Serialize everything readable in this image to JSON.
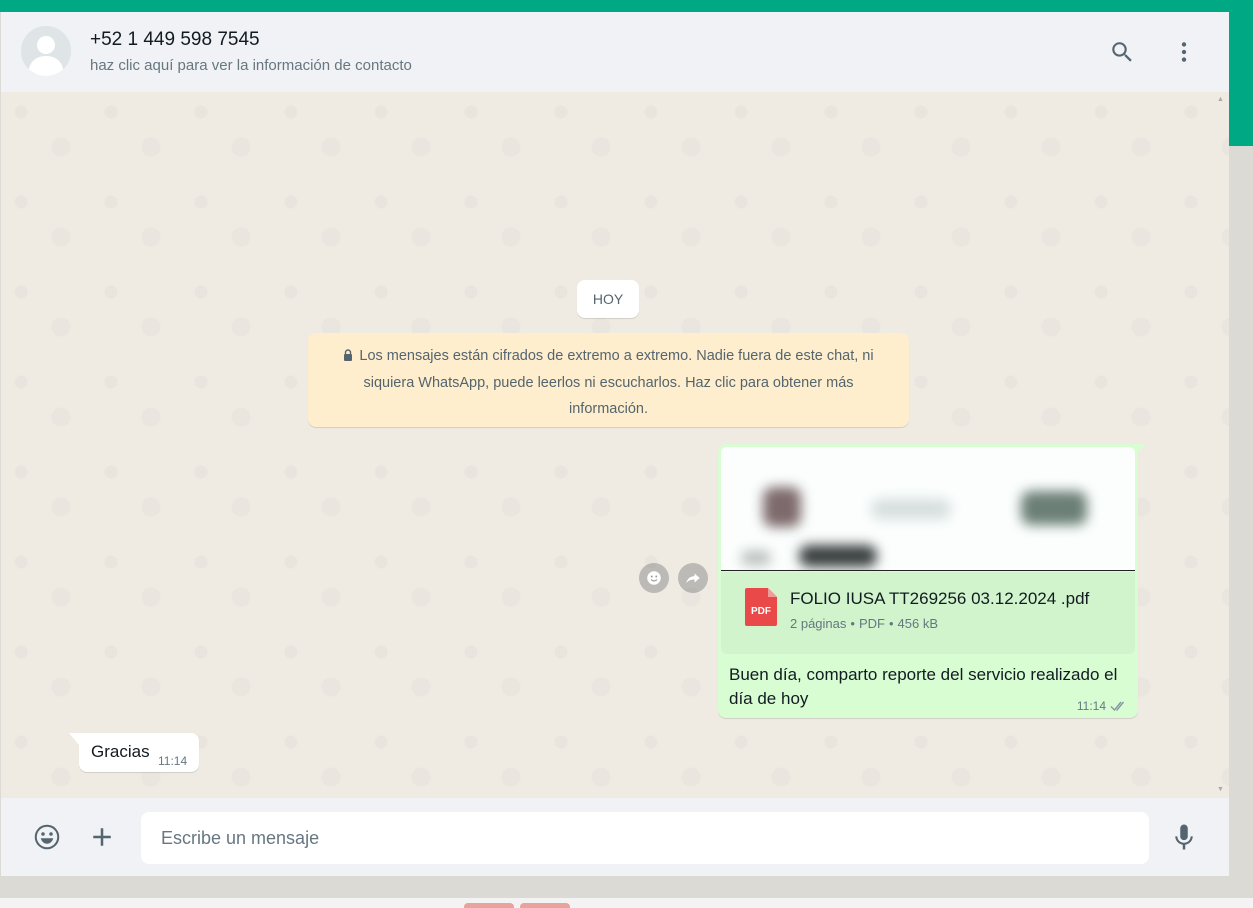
{
  "header": {
    "contact_name": "+52 1 449 598 7545",
    "contact_subtitle": "haz clic aquí para ver la información de contacto",
    "icons": [
      "avatar-placeholder-icon",
      "search-icon",
      "menu-kebab-icon"
    ]
  },
  "chat": {
    "day_label": "HOY",
    "encryption_notice": "Los mensajes están cifrados de extremo a extremo. Nadie fuera de este chat, ni siquiera WhatsApp, puede leerlos ni escucharlos. Haz clic para obtener más información.",
    "outgoing": {
      "document": {
        "icon_label": "PDF",
        "file_name": "FOLIO IUSA TT269256 03.12.2024 .pdf",
        "pages": "2 páginas",
        "type": "PDF",
        "size": "456 kB",
        "separator": "•"
      },
      "caption": "Buen día, comparto reporte del servicio realizado el día de hoy",
      "time": "11:14",
      "status": "read-double-check"
    },
    "incoming": {
      "text": "Gracias",
      "time": "11:14"
    }
  },
  "footer": {
    "input_placeholder": "Escribe un mensaje",
    "icons": [
      "emoji-icon",
      "attach-plus-icon",
      "microphone-icon"
    ]
  },
  "colors": {
    "accent": "#00a884",
    "outgoing_bubble": "#d9fdd3",
    "encryption_bg": "#ffeecd",
    "pdf_red": "#e94949"
  }
}
